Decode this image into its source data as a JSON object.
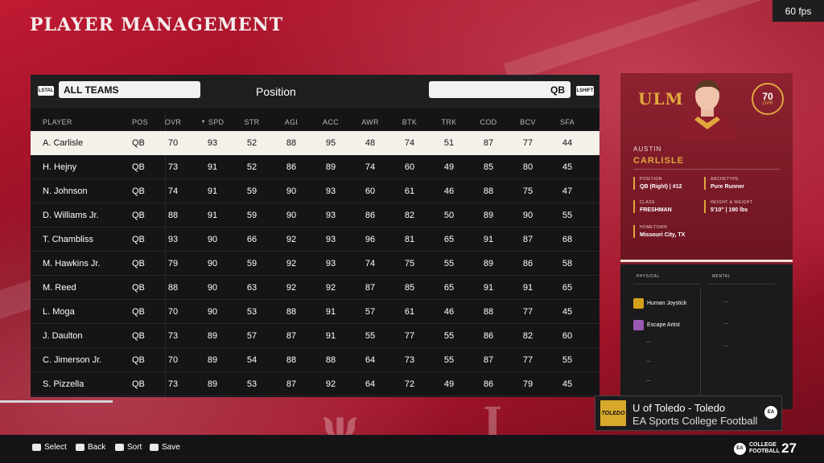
{
  "fps": "60 fps",
  "page_title": "PLAYER MANAGEMENT",
  "filter": {
    "left_badge": "LSTAL",
    "team": "ALL TEAMS",
    "label": "Position",
    "position": "QB",
    "right_badge": "LSHIFT"
  },
  "columns": [
    "PLAYER",
    "POS",
    "OVR",
    "SPD",
    "STR",
    "AGI",
    "ACC",
    "AWR",
    "BTK",
    "TRK",
    "COD",
    "BCV",
    "SFA"
  ],
  "sort_indicator": "▼",
  "players": [
    {
      "name": "A. Carlisle",
      "pos": "QB",
      "stats": [
        "70",
        "93",
        "52",
        "88",
        "95",
        "48",
        "74",
        "51",
        "87",
        "77",
        "44"
      ]
    },
    {
      "name": "H. Hejny",
      "pos": "QB",
      "stats": [
        "73",
        "91",
        "52",
        "86",
        "89",
        "74",
        "60",
        "49",
        "85",
        "80",
        "45"
      ]
    },
    {
      "name": "N. Johnson",
      "pos": "QB",
      "stats": [
        "74",
        "91",
        "59",
        "90",
        "93",
        "60",
        "61",
        "46",
        "88",
        "75",
        "47"
      ]
    },
    {
      "name": "D. Williams Jr.",
      "pos": "QB",
      "stats": [
        "88",
        "91",
        "59",
        "90",
        "93",
        "86",
        "82",
        "50",
        "89",
        "90",
        "55"
      ]
    },
    {
      "name": "T. Chambliss",
      "pos": "QB",
      "stats": [
        "93",
        "90",
        "66",
        "92",
        "93",
        "96",
        "81",
        "65",
        "91",
        "87",
        "68"
      ]
    },
    {
      "name": "M. Hawkins Jr.",
      "pos": "QB",
      "stats": [
        "79",
        "90",
        "59",
        "92",
        "93",
        "74",
        "75",
        "55",
        "89",
        "86",
        "58"
      ]
    },
    {
      "name": "M. Reed",
      "pos": "QB",
      "stats": [
        "88",
        "90",
        "63",
        "92",
        "92",
        "87",
        "85",
        "65",
        "91",
        "91",
        "65"
      ]
    },
    {
      "name": "L. Moga",
      "pos": "QB",
      "stats": [
        "70",
        "90",
        "53",
        "88",
        "91",
        "57",
        "61",
        "46",
        "88",
        "77",
        "45"
      ]
    },
    {
      "name": "J. Daulton",
      "pos": "QB",
      "stats": [
        "73",
        "89",
        "57",
        "87",
        "91",
        "55",
        "77",
        "55",
        "86",
        "82",
        "60"
      ]
    },
    {
      "name": "C. Jimerson Jr.",
      "pos": "QB",
      "stats": [
        "70",
        "89",
        "54",
        "88",
        "88",
        "64",
        "73",
        "55",
        "87",
        "77",
        "55"
      ]
    },
    {
      "name": "S. Pizzella",
      "pos": "QB",
      "stats": [
        "73",
        "89",
        "53",
        "87",
        "92",
        "64",
        "72",
        "49",
        "86",
        "79",
        "45"
      ]
    }
  ],
  "card": {
    "logo": "ULM",
    "ovr": "70",
    "ovr_label": "OVR",
    "first_name": "AUSTIN",
    "last_name": "CARLISLE",
    "position_label": "POSITION",
    "position_value": "QB (Right) | #12",
    "archetype_label": "ARCHETYPE",
    "archetype_value": "Pure Runner",
    "class_label": "CLASS",
    "class_value": "FRESHMAN",
    "height_weight_label": "HEIGHT & WEIGHT",
    "height_weight_value": "5'10\" | 190 lbs",
    "hometown_label": "HOMETOWN",
    "hometown_value": "Missouri City, TX",
    "physical_label": "PHYSICAL",
    "mental_label": "MENTAL",
    "abilities": [
      {
        "name": "Human Joystick",
        "color": "#d4a017"
      },
      {
        "name": "Escape Artist",
        "color": "#9b59b6"
      }
    ],
    "placeholder": "..."
  },
  "now_playing": {
    "art_text": "TOLEDO",
    "title": "U of Toledo - Toledo",
    "subtitle": "EA Sports College Football",
    "badge": "EA"
  },
  "footer": {
    "hints": [
      "Select",
      "Back",
      "Sort",
      "Save"
    ],
    "brand_badge": "EA",
    "brand_line1": "COLLEGE",
    "brand_line2": "FOOTBALL",
    "brand_year": "27"
  },
  "colors": {
    "accent_gold": "#e1a73e",
    "background_red": "#a3142a",
    "selected_row": "#f3f1ea",
    "table_bg": "#151517"
  }
}
